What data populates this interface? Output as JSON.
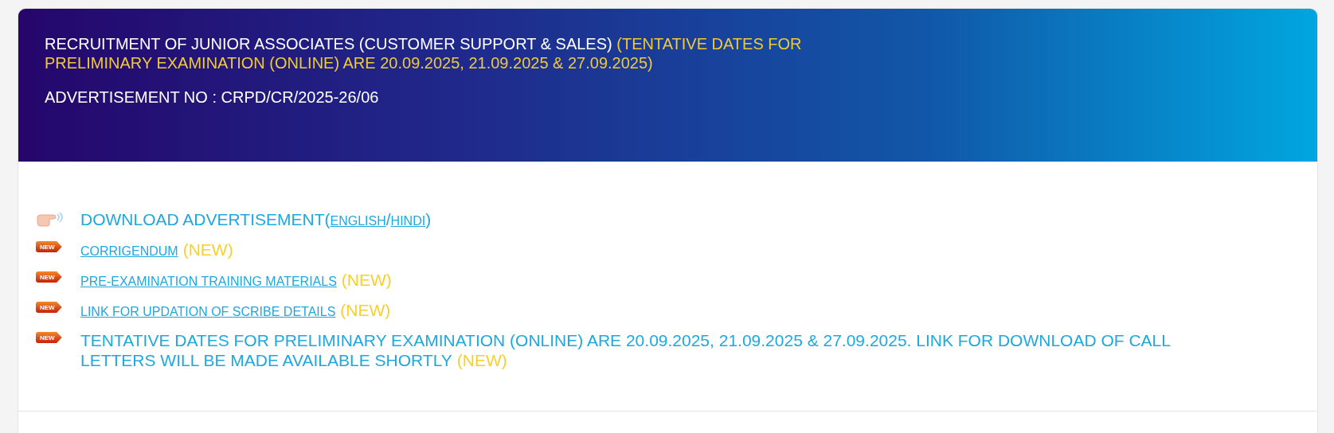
{
  "header": {
    "title": "RECRUITMENT OF JUNIOR ASSOCIATES (CUSTOMER SUPPORT & SALES)",
    "title_note": "(TENTATIVE DATES FOR PRELIMINARY EXAMINATION (ONLINE) ARE 20.09.2025, 21.09.2025 & 27.09.2025)",
    "advertisement": "ADVERTISEMENT NO : CRPD/CR/2025-26/06"
  },
  "items": [
    {
      "kind": "hand",
      "parts": [
        {
          "kind": "text",
          "text": "DOWNLOAD ADVERTISEMENT("
        },
        {
          "kind": "link",
          "text": "ENGLISH"
        },
        {
          "kind": "text",
          "text": "/"
        },
        {
          "kind": "link",
          "text": "HINDI"
        },
        {
          "kind": "text",
          "text": ")"
        }
      ]
    },
    {
      "kind": "badge",
      "badge": "NEW",
      "parts": [
        {
          "kind": "link",
          "text": "CORRIGENDUM"
        },
        {
          "kind": "tag",
          "text": "(NEW)"
        }
      ]
    },
    {
      "kind": "badge",
      "badge": "NEW",
      "parts": [
        {
          "kind": "link",
          "text": "PRE-EXAMINATION TRAINING MATERIALS"
        },
        {
          "kind": "tag",
          "text": "(NEW)"
        }
      ]
    },
    {
      "kind": "badge",
      "badge": "NEW",
      "parts": [
        {
          "kind": "link",
          "text": "LINK FOR UPDATION OF SCRIBE DETAILS"
        },
        {
          "kind": "tag",
          "text": "(NEW)"
        }
      ]
    },
    {
      "kind": "badge",
      "badge": "NEW",
      "parts": [
        {
          "kind": "text",
          "text": "TENTATIVE DATES FOR PRELIMINARY EXAMINATION (ONLINE) ARE 20.09.2025, 21.09.2025 & 27.09.2025. LINK FOR DOWNLOAD OF CALL LETTERS WILL BE MADE AVAILABLE SHORTLY"
        },
        {
          "kind": "tag",
          "text": "(NEW)"
        }
      ]
    }
  ]
}
